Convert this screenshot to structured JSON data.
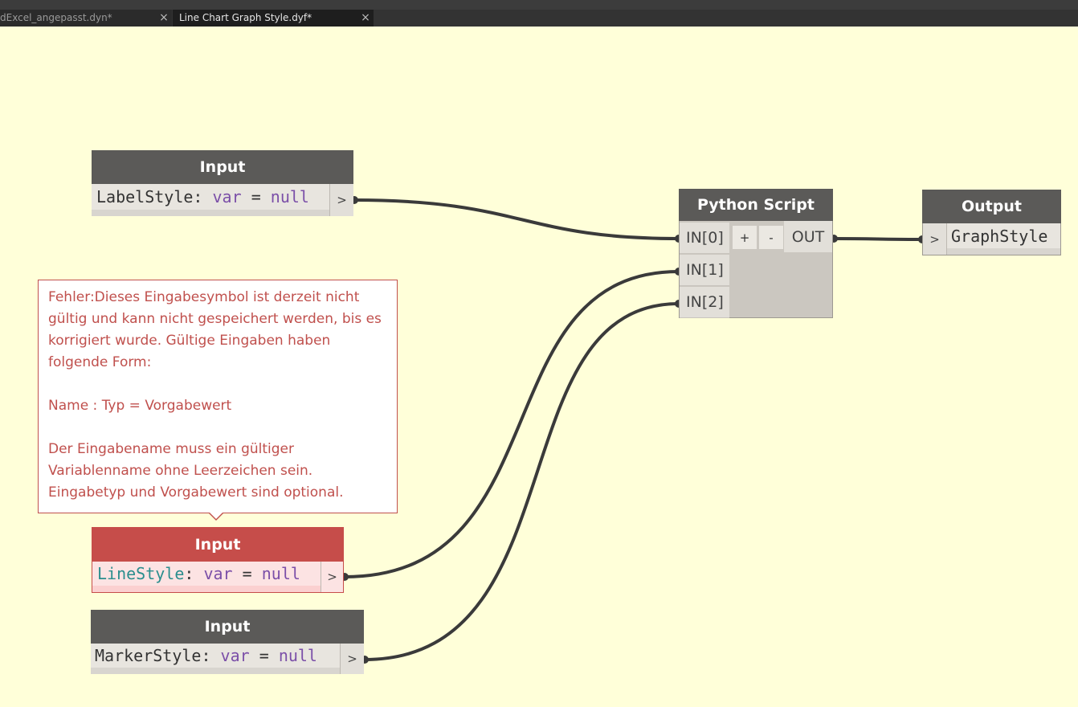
{
  "tabs": [
    {
      "label": "dExcel_angepasst.dyn*",
      "close": "×"
    },
    {
      "label": "Line Chart Graph Style.dyf*",
      "close": "×"
    }
  ],
  "nodes": {
    "label_input": {
      "title": "Input",
      "name": "LabelStyle",
      "type": "var",
      "default": "null",
      "port": ">"
    },
    "line_input": {
      "title": "Input",
      "name": "LineStyle",
      "type": "var",
      "default": "null",
      "port": ">"
    },
    "marker_input": {
      "title": "Input",
      "name": "MarkerStyle",
      "type": "var",
      "default": "null",
      "port": ">"
    },
    "python": {
      "title": "Python Script",
      "inputs": [
        "IN[0]",
        "IN[1]",
        "IN[2]"
      ],
      "add": "+",
      "remove": "-",
      "output": "OUT"
    },
    "output": {
      "title": "Output",
      "name": "GraphStyle",
      "port": ">"
    }
  },
  "syntax": {
    "colon": ":",
    "equals": "="
  },
  "error_tooltip": {
    "text": "Fehler:Dieses Eingabesymbol ist derzeit nicht gültig und kann nicht gespeichert werden, bis es korrigiert wurde. Gültige Eingaben haben folgende Form:\n\nName : Typ = Vorgabewert\n\nDer Eingabename muss ein gültiger Variablenname ohne Leerzeichen sein. Eingabetyp und Vorgabewert sind optional."
  },
  "colors": {
    "canvas": "#ffffd9",
    "node_header": "#5b5a58",
    "error": "#c64d4a",
    "wire": "#3a3a3a"
  }
}
